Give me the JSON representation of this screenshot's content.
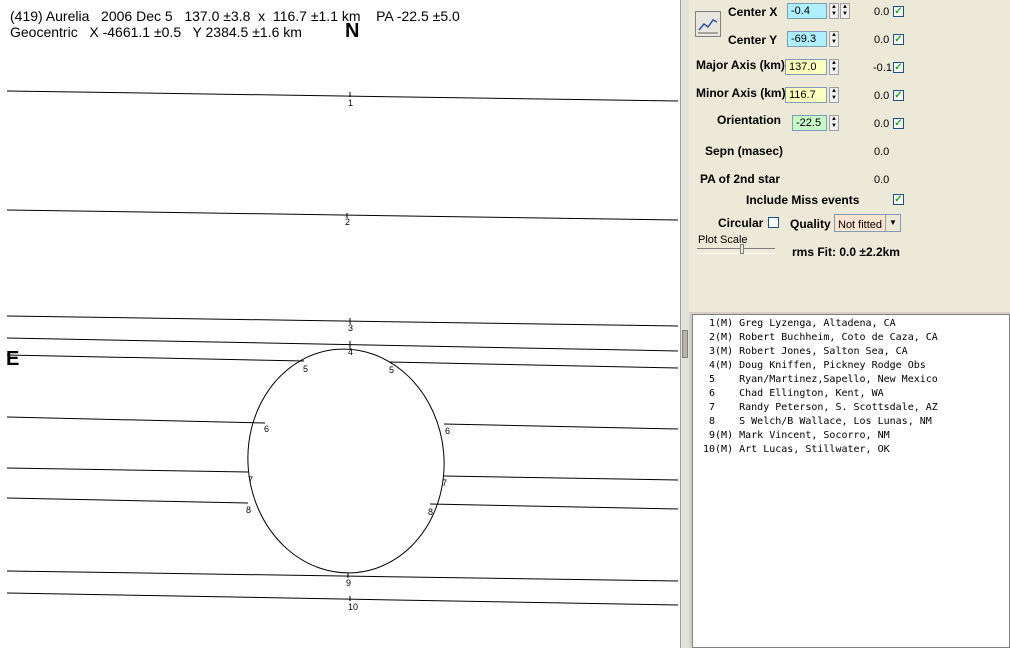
{
  "plot": {
    "header_line1": "(419) Aurelia   2006 Dec 5   137.0 ±3.8  x  116.7 ±1.1 km    PA -22.5 ±5.0",
    "header_line2": "Geocentric   X -4661.1 ±0.5   Y 2384.5 ±1.6 km",
    "north_label": "N",
    "east_label": "E",
    "chord_labels": [
      "1",
      "2",
      "3",
      "4",
      "5",
      "5",
      "6",
      "6",
      "7",
      "7",
      "8",
      "8",
      "9",
      "10"
    ]
  },
  "panel": {
    "center_x": {
      "label": "Center X",
      "value": "-0.4",
      "offset": "0.0"
    },
    "center_y": {
      "label": "Center Y",
      "value": "-69.3",
      "offset": "0.0"
    },
    "major_axis": {
      "label": "Major Axis (km)",
      "value": "137.0",
      "offset": "-0.1"
    },
    "minor_axis": {
      "label": "Minor Axis (km)",
      "value": "116.7",
      "offset": "0.0"
    },
    "orientation": {
      "label": "Orientation",
      "value": "-22.5",
      "offset": "0.0"
    },
    "sepn": {
      "label": "Sepn (masec)",
      "value": "0.0"
    },
    "pa_2nd_star": {
      "label": "PA of 2nd star",
      "value": "0.0"
    },
    "include_miss_label": "Include Miss events",
    "circular_label": "Circular",
    "quality_label": "Quality",
    "quality_value": "Not fitted",
    "plot_scale_label": "Plot Scale",
    "rms_fit": "rms Fit: 0.0 ±2.2km",
    "check_mark": "✓",
    "spin_up": "▲",
    "spin_down": "▼",
    "dropdown_arrow": "▼"
  },
  "observers": [
    " 1(M) Greg Lyzenga, Altadena, CA",
    " 2(M) Robert Buchheim, Coto de Caza, CA",
    " 3(M) Robert Jones, Salton Sea, CA",
    " 4(M) Doug Kniffen, Pickney Rodge Obs",
    " 5    Ryan/Martinez,Sapello, New Mexico",
    " 6    Chad Ellington, Kent, WA",
    " 7    Randy Peterson, S. Scottsdale, AZ",
    " 8    S Welch/B Wallace, Los Lunas, NM",
    " 9(M) Mark Vincent, Socorro, NM",
    "10(M) Art Lucas, Stillwater, OK"
  ]
}
